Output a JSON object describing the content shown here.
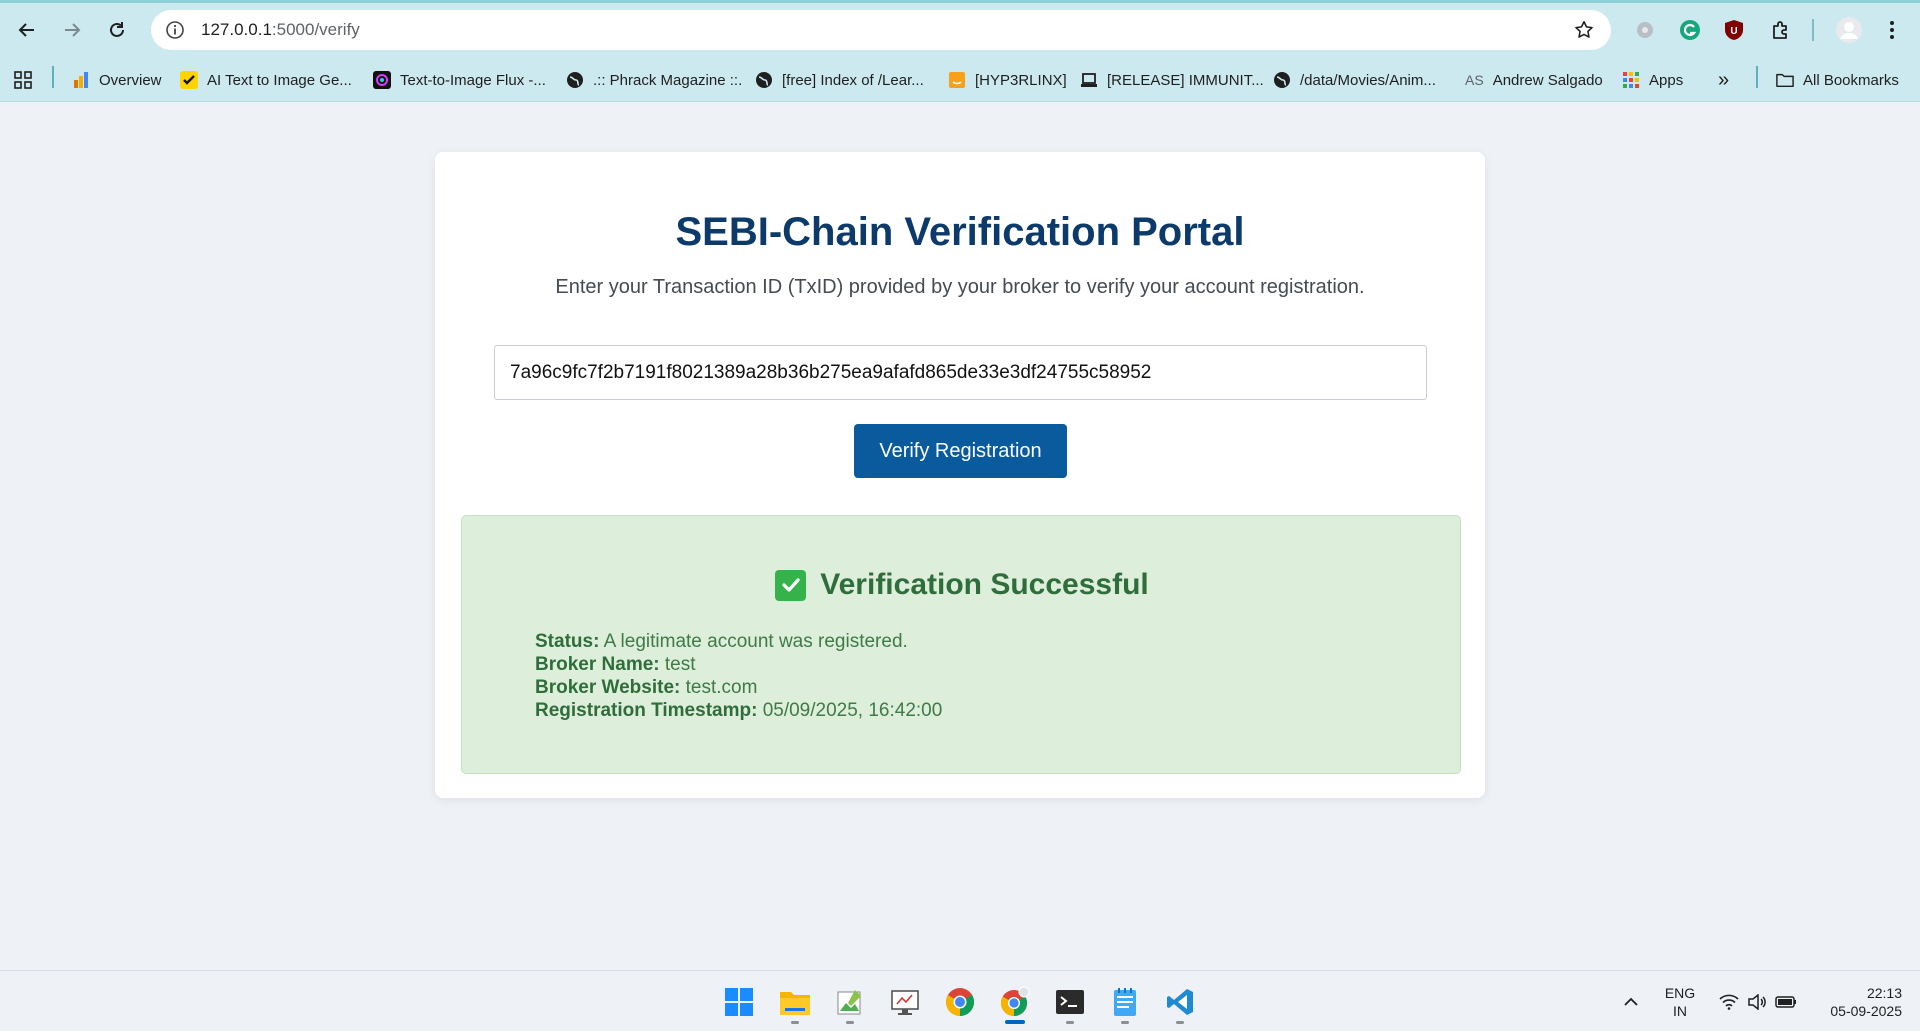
{
  "browser": {
    "url_host": "127.0.0.1",
    "url_path": ":5000/verify",
    "bookmarks": [
      {
        "label": "Overview"
      },
      {
        "label": "AI Text to Image Ge..."
      },
      {
        "label": "Text-to-Image Flux -..."
      },
      {
        "label": ".:: Phrack Magazine ::."
      },
      {
        "label": "[free] Index of /Lear..."
      },
      {
        "label": "[HYP3RLINX]"
      },
      {
        "label": "[RELEASE] IMMUNIT..."
      },
      {
        "label": "/data/Movies/Anim..."
      },
      {
        "label": "Andrew Salgado",
        "icon_text": "AS"
      },
      {
        "label": "Apps"
      }
    ],
    "more_label": "»",
    "all_bookmarks_label": "All Bookmarks"
  },
  "portal": {
    "title": "SEBI-Chain Verification Portal",
    "subtitle": "Enter your Transaction ID (TxID) provided by your broker to verify your account registration.",
    "txid_value": "7a96c9fc7f2b7191f8021389a28b36b275ea9afafd865de33e3df24755c58952",
    "verify_button": "Verify Registration"
  },
  "result": {
    "title": "Verification Successful",
    "fields": [
      {
        "label": "Status:",
        "value": "A legitimate account was registered."
      },
      {
        "label": "Broker Name:",
        "value": "test"
      },
      {
        "label": "Broker Website:",
        "value": "test.com"
      },
      {
        "label": "Registration Timestamp:",
        "value": "05/09/2025, 16:42:00"
      }
    ]
  },
  "taskbar": {
    "lang_line1": "ENG",
    "lang_line2": "IN",
    "time": "22:13",
    "date": "05-09-2025"
  },
  "colors": {
    "title": "#0b3a6b",
    "button": "#0a5a9e",
    "success_bg": "#ddeedb",
    "success_text": "#2f6e3a"
  }
}
